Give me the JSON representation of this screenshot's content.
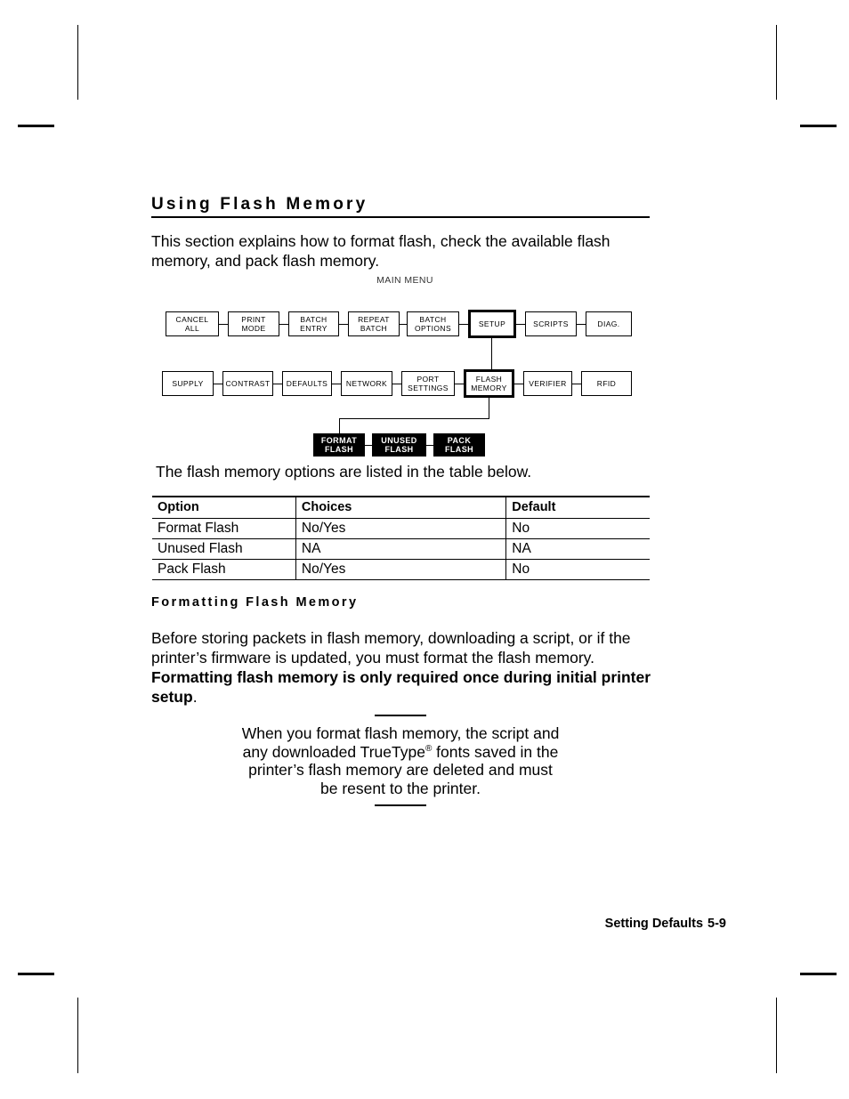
{
  "document": {
    "heading": "Using Flash Memory",
    "intro_paragraph": "This section explains how to format flash, check the available flash memory, and pack flash memory.",
    "table_intro": "The flash memory options are listed in the table below.",
    "subheading": "Formatting Flash Memory",
    "format_paragraph_plain": "Before storing packets in flash memory, downloading a script, or if the printer’s firmware is updated, you must format the flash memory.  ",
    "format_paragraph_bold": "Formatting flash memory is only required once during initial printer setup",
    "format_paragraph_tail": "."
  },
  "menu_tree": {
    "title": "MAIN MENU",
    "row1": [
      {
        "label_line1": "CANCEL",
        "label_line2": "ALL",
        "highlighted": false
      },
      {
        "label_line1": "PRINT",
        "label_line2": "MODE",
        "highlighted": false
      },
      {
        "label_line1": "BATCH",
        "label_line2": "ENTRY",
        "highlighted": false
      },
      {
        "label_line1": "REPEAT",
        "label_line2": "BATCH",
        "highlighted": false
      },
      {
        "label_line1": "BATCH",
        "label_line2": "OPTIONS",
        "highlighted": false
      },
      {
        "label_line1": "SETUP",
        "label_line2": "",
        "highlighted": true
      },
      {
        "label_line1": "SCRIPTS",
        "label_line2": "",
        "highlighted": false
      },
      {
        "label_line1": "DIAG.",
        "label_line2": "",
        "highlighted": false
      }
    ],
    "row2": [
      {
        "label_line1": "SUPPLY",
        "label_line2": "",
        "highlighted": false
      },
      {
        "label_line1": "CONTRAST",
        "label_line2": "",
        "highlighted": false
      },
      {
        "label_line1": "DEFAULTS",
        "label_line2": "",
        "highlighted": false
      },
      {
        "label_line1": "NETWORK",
        "label_line2": "",
        "highlighted": false
      },
      {
        "label_line1": "PORT",
        "label_line2": "SETTINGS",
        "highlighted": false
      },
      {
        "label_line1": "FLASH",
        "label_line2": "MEMORY",
        "highlighted": true
      },
      {
        "label_line1": "VERIFIER",
        "label_line2": "",
        "highlighted": false
      },
      {
        "label_line1": "RFID",
        "label_line2": "",
        "highlighted": false
      }
    ],
    "row3": [
      {
        "label_line1": "FORMAT",
        "label_line2": "FLASH",
        "inverted": true
      },
      {
        "label_line1": "UNUSED",
        "label_line2": "FLASH",
        "inverted": true
      },
      {
        "label_line1": "PACK",
        "label_line2": "FLASH",
        "inverted": true
      }
    ]
  },
  "options_table": {
    "headers": [
      "Option",
      "Choices",
      "Default"
    ],
    "rows": [
      {
        "option": "Format Flash",
        "choices": "No/Yes",
        "default": "No"
      },
      {
        "option": "Unused Flash",
        "choices": "NA",
        "default": "NA"
      },
      {
        "option": "Pack Flash",
        "choices": "No/Yes",
        "default": "No"
      }
    ]
  },
  "note": {
    "line1": "When you format flash memory, the script and",
    "line2_a": "any downloaded TrueType",
    "line2_mark": "®",
    "line2_b": " fonts saved in the",
    "line3": "printer’s flash memory are deleted and must",
    "line4": "be resent to the printer."
  },
  "footer": {
    "section": "Setting Defaults",
    "page": "5-9"
  },
  "colors": {
    "ink": "#000000",
    "paper": "#ffffff",
    "inverted_text": "#ffffff"
  }
}
